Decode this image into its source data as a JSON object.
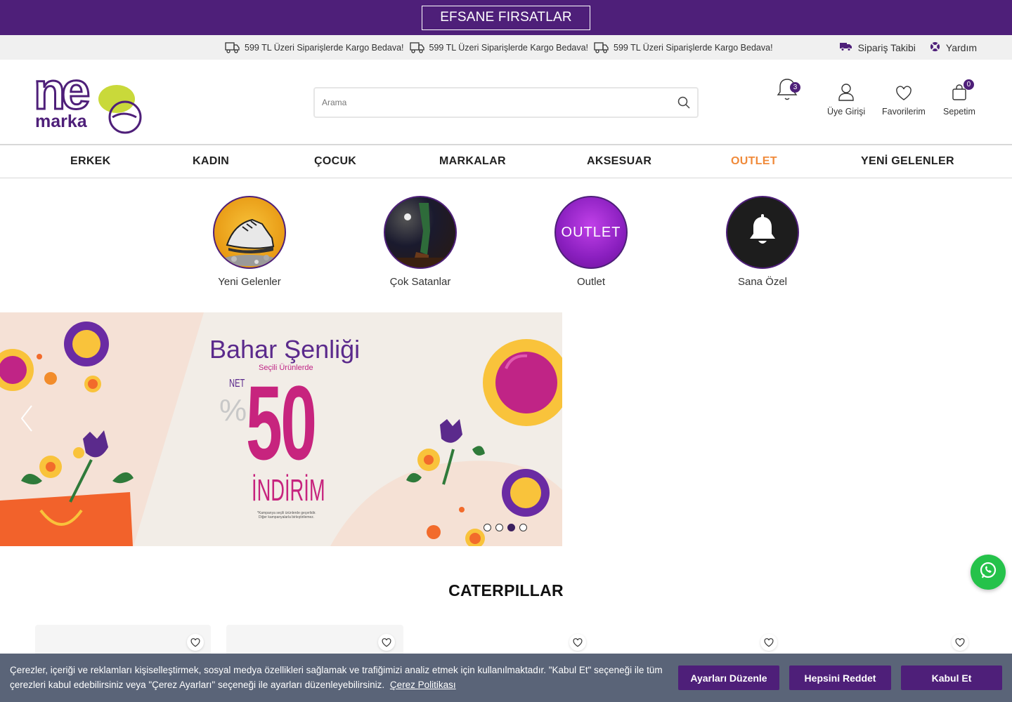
{
  "promo": {
    "button_label": "EFSANE FIRSATLAR"
  },
  "info_strip": {
    "shipping_messages": [
      "599 TL Üzeri Siparişlerde Kargo Bedava!",
      "599 TL Üzeri Siparişlerde Kargo Bedava!",
      "599 TL Üzeri Siparişlerde Kargo Bedava!"
    ],
    "order_tracking": "Sipariş Takibi",
    "help": "Yardım"
  },
  "header": {
    "logo_text_top": "ne",
    "logo_text_bottom": "marka",
    "search_placeholder": "Arama",
    "notifications_count": "3",
    "login_label": "Üye Girişi",
    "favorites_label": "Favorilerim",
    "cart_label": "Sepetim",
    "cart_count": "0"
  },
  "nav": {
    "items": [
      "ERKEK",
      "KADIN",
      "ÇOCUK",
      "MARKALAR",
      "AKSESUAR",
      "OUTLET",
      "YENİ GELENLER"
    ],
    "highlight_color": "#f08a3a"
  },
  "stories": [
    {
      "label": "Yeni Gelenler"
    },
    {
      "label": "Çok Satanlar"
    },
    {
      "label": "Outlet",
      "circle_text": "OUTLET"
    },
    {
      "label": "Sana Özel"
    }
  ],
  "banner": {
    "title": "Bahar Şenliği",
    "subtitle": "Seçili Ürünlerde",
    "net": "NET",
    "percent": "%",
    "discount": "50",
    "indirim": "İNDİRİM",
    "fine_print_1": "*Kampanya seçili ürünlerde geçerlidir.",
    "fine_print_2": "Diğer kampanyalarla birleştirilemez.",
    "slide_count": 4,
    "active_slide": 3
  },
  "section": {
    "title": "CATERPILLAR"
  },
  "cookie": {
    "text": "Çerezler, içeriği ve reklamları kişiselleştirmek, sosyal medya özellikleri sağlamak ve trafiğimizi analiz etmek için kullanılmaktadır. \"Kabul Et\" seçeneği ile tüm çerezleri kabul edebilirsiniz veya \"Çerez Ayarları\" seçeneği ile ayarları düzenleyebilirsiniz.",
    "policy_link": "Çerez Politikası",
    "btn_settings": "Ayarları Düzenle",
    "btn_reject": "Hepsini Reddet",
    "btn_accept": "Kabul Et"
  },
  "colors": {
    "brand_purple": "#4e1f79",
    "outlet_orange": "#f08a3a",
    "whatsapp_green": "#25c24a",
    "cookie_bg": "#5a6478"
  }
}
